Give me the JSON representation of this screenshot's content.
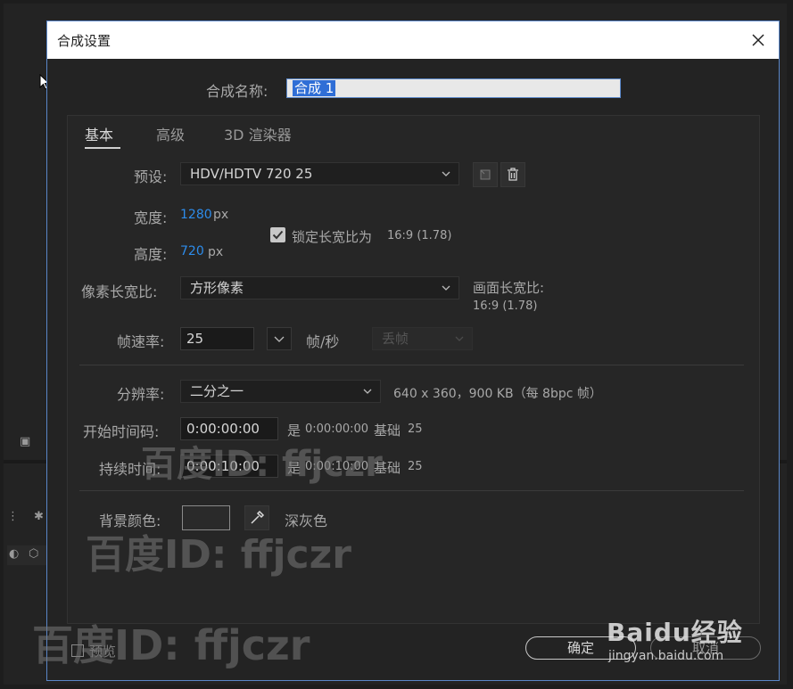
{
  "dialog": {
    "title": "合成设置",
    "name_label": "合成名称:",
    "name_value": "合成 1"
  },
  "tabs": [
    {
      "label": "基本",
      "active": true
    },
    {
      "label": "高级",
      "active": false
    },
    {
      "label": "3D 渲染器",
      "active": false
    }
  ],
  "basic": {
    "preset_label": "预设:",
    "preset_value": "HDV/HDTV 720 25",
    "width_label": "宽度:",
    "width_value": "1280",
    "height_label": "高度:",
    "height_value": "720",
    "unit": "px",
    "lock_label": "锁定长宽比为",
    "lock_ratio": "16:9 (1.78)",
    "lock_checked": true,
    "pixel_aspect_label": "像素长宽比:",
    "pixel_aspect_value": "方形像素",
    "frame_aspect_label": "画面长宽比:",
    "frame_aspect_value": "16:9 (1.78)",
    "framerate_label": "帧速率:",
    "framerate_value": "25",
    "fps_label": "帧/秒",
    "drop_frame": "丢帧",
    "resolution_label": "分辨率:",
    "resolution_value": "二分之一",
    "resolution_info": "640 x 360，900 KB（每 8bpc 帧）",
    "start_tc_label": "开始时间码:",
    "start_tc_value": "0:00:00:00",
    "start_tc_is": "是",
    "start_tc_info": "0:00:00:00",
    "base_label": "基础",
    "base_value": "25",
    "duration_label": "持续时间:",
    "duration_value": "0:00:10:00",
    "duration_is": "是",
    "duration_info": "0:00:10:00",
    "bg_color_label": "背景颜色:",
    "bg_color_name": "深灰色",
    "bg_color_hex": "#2a2a2a"
  },
  "footer": {
    "preview_label": "预览",
    "ok_label": "确定",
    "cancel_label": "取消"
  },
  "watermarks": {
    "text": "百度ID: ffjczr",
    "baidu_brand": "Baidu经验",
    "baidu_url": "jingyan.baidu.com"
  },
  "colors": {
    "accent_blue": "#2d8ceb",
    "selection": "#2f6ed6",
    "dialog_border": "#5a86c8"
  },
  "icons": {
    "save_preset": "save-preset-icon",
    "delete_preset": "trash-icon",
    "eyedropper": "eyedropper-icon",
    "close": "close-icon"
  }
}
